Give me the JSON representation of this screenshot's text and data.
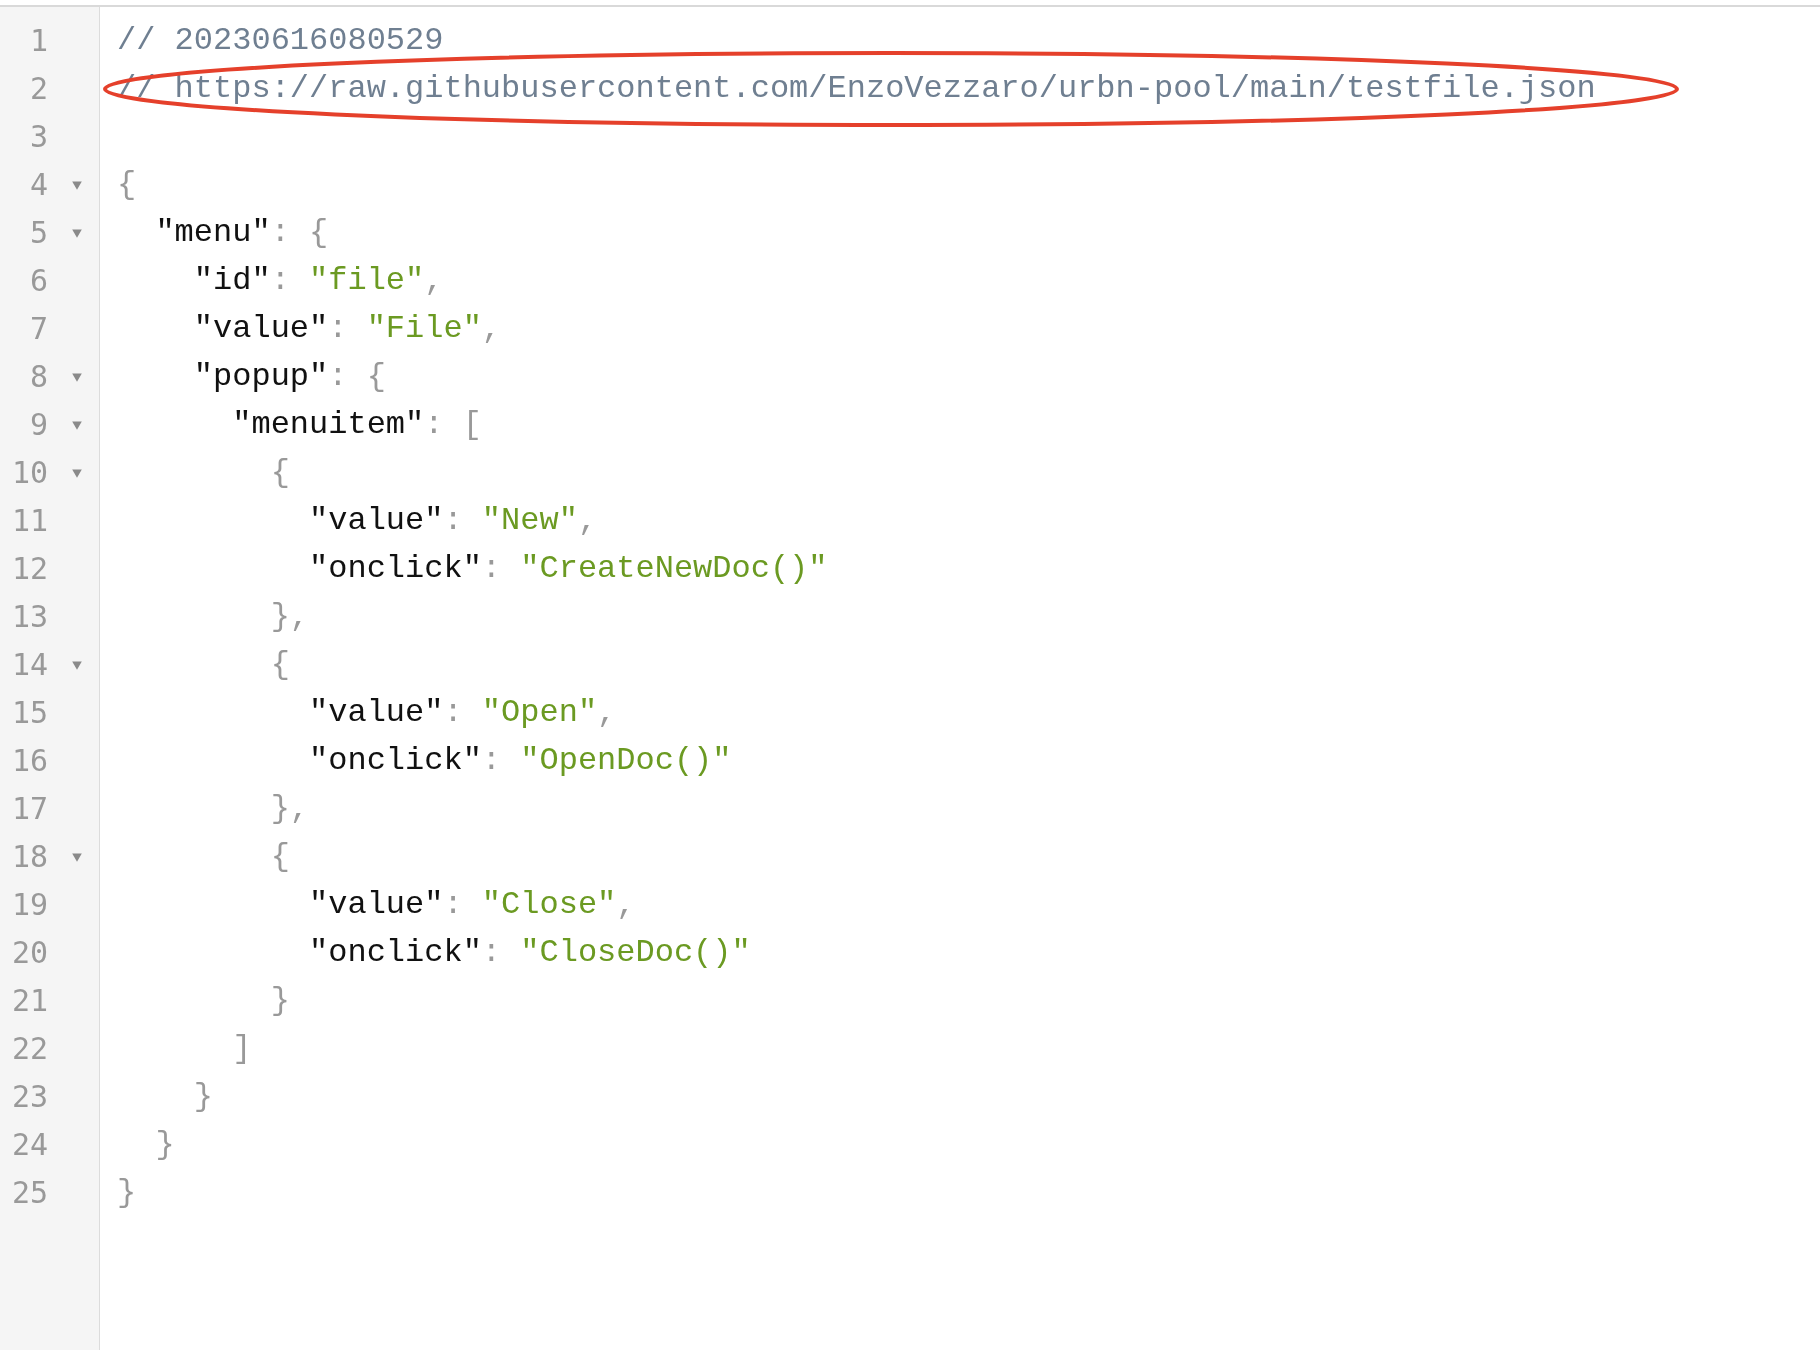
{
  "lines": [
    {
      "number": "1",
      "tokens": [
        {
          "kind": "comment",
          "text": "// 20230616080529"
        }
      ]
    },
    {
      "number": "2",
      "circled": true,
      "tokens": [
        {
          "kind": "comment",
          "text": "// https://raw.githubusercontent.com/EnzoVezzaro/urbn-pool/main/testfile.json"
        }
      ]
    },
    {
      "number": "3"
    },
    {
      "number": "4",
      "foldable": true,
      "tokens": [
        {
          "kind": "punct",
          "text": "{"
        }
      ]
    },
    {
      "number": "5",
      "foldable": true,
      "tokens": [
        {
          "kind": "key",
          "text": "  \"menu\""
        },
        {
          "kind": "punct",
          "text": ": {"
        }
      ]
    },
    {
      "number": "6",
      "tokens": [
        {
          "kind": "key",
          "text": "    \"id\""
        },
        {
          "kind": "punct",
          "text": ": "
        },
        {
          "kind": "string",
          "text": "\"file\""
        },
        {
          "kind": "punct",
          "text": ","
        }
      ]
    },
    {
      "number": "7",
      "tokens": [
        {
          "kind": "key",
          "text": "    \"value\""
        },
        {
          "kind": "punct",
          "text": ": "
        },
        {
          "kind": "string",
          "text": "\"File\""
        },
        {
          "kind": "punct",
          "text": ","
        }
      ]
    },
    {
      "number": "8",
      "foldable": true,
      "tokens": [
        {
          "kind": "key",
          "text": "    \"popup\""
        },
        {
          "kind": "punct",
          "text": ": {"
        }
      ]
    },
    {
      "number": "9",
      "foldable": true,
      "tokens": [
        {
          "kind": "key",
          "text": "      \"menuitem\""
        },
        {
          "kind": "punct",
          "text": ": ["
        }
      ]
    },
    {
      "number": "10",
      "foldable": true,
      "tokens": [
        {
          "kind": "punct",
          "text": "        {"
        }
      ]
    },
    {
      "number": "11",
      "tokens": [
        {
          "kind": "key",
          "text": "          \"value\""
        },
        {
          "kind": "punct",
          "text": ": "
        },
        {
          "kind": "string",
          "text": "\"New\""
        },
        {
          "kind": "punct",
          "text": ","
        }
      ]
    },
    {
      "number": "12",
      "tokens": [
        {
          "kind": "key",
          "text": "          \"onclick\""
        },
        {
          "kind": "punct",
          "text": ": "
        },
        {
          "kind": "string",
          "text": "\"CreateNewDoc()\""
        }
      ]
    },
    {
      "number": "13",
      "tokens": [
        {
          "kind": "punct",
          "text": "        },"
        }
      ]
    },
    {
      "number": "14",
      "foldable": true,
      "tokens": [
        {
          "kind": "punct",
          "text": "        {"
        }
      ]
    },
    {
      "number": "15",
      "tokens": [
        {
          "kind": "key",
          "text": "          \"value\""
        },
        {
          "kind": "punct",
          "text": ": "
        },
        {
          "kind": "string",
          "text": "\"Open\""
        },
        {
          "kind": "punct",
          "text": ","
        }
      ]
    },
    {
      "number": "16",
      "tokens": [
        {
          "kind": "key",
          "text": "          \"onclick\""
        },
        {
          "kind": "punct",
          "text": ": "
        },
        {
          "kind": "string",
          "text": "\"OpenDoc()\""
        }
      ]
    },
    {
      "number": "17",
      "tokens": [
        {
          "kind": "punct",
          "text": "        },"
        }
      ]
    },
    {
      "number": "18",
      "foldable": true,
      "tokens": [
        {
          "kind": "punct",
          "text": "        {"
        }
      ]
    },
    {
      "number": "19",
      "tokens": [
        {
          "kind": "key",
          "text": "          \"value\""
        },
        {
          "kind": "punct",
          "text": ": "
        },
        {
          "kind": "string",
          "text": "\"Close\""
        },
        {
          "kind": "punct",
          "text": ","
        }
      ]
    },
    {
      "number": "20",
      "tokens": [
        {
          "kind": "key",
          "text": "          \"onclick\""
        },
        {
          "kind": "punct",
          "text": ": "
        },
        {
          "kind": "string",
          "text": "\"CloseDoc()\""
        }
      ]
    },
    {
      "number": "21",
      "tokens": [
        {
          "kind": "punct",
          "text": "        }"
        }
      ]
    },
    {
      "number": "22",
      "tokens": [
        {
          "kind": "punct",
          "text": "      ]"
        }
      ]
    },
    {
      "number": "23",
      "tokens": [
        {
          "kind": "punct",
          "text": "    }"
        }
      ]
    },
    {
      "number": "24",
      "tokens": [
        {
          "kind": "punct",
          "text": "  }"
        }
      ]
    },
    {
      "number": "25",
      "tokens": [
        {
          "kind": "punct",
          "text": "}"
        }
      ]
    }
  ]
}
